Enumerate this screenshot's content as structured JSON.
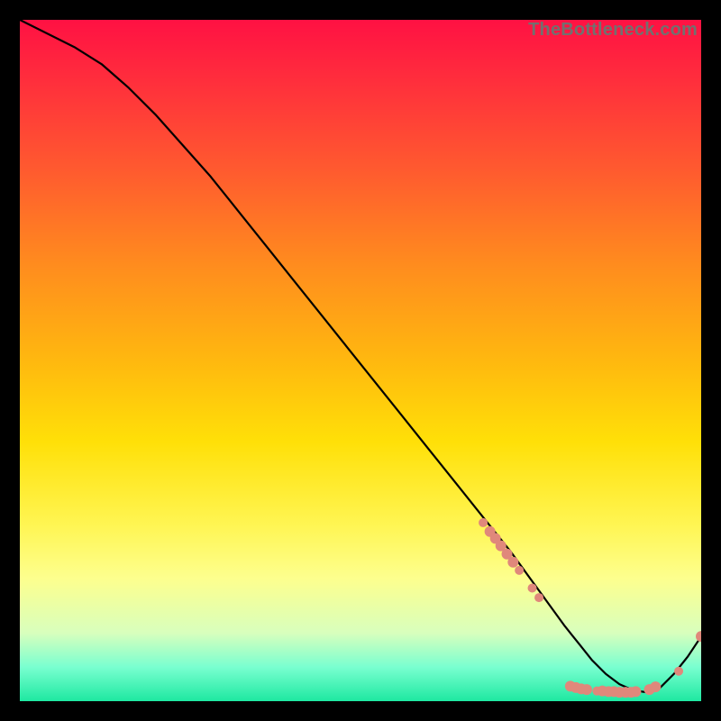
{
  "watermark": "TheBottleneck.com",
  "chart_data": {
    "type": "line",
    "title": "",
    "xlabel": "",
    "ylabel": "",
    "xlim": [
      0,
      100
    ],
    "ylim": [
      0,
      100
    ],
    "grid": false,
    "legend": false,
    "curve": {
      "name": "bottleneck-curve",
      "x": [
        0,
        4,
        8,
        12,
        16,
        20,
        24,
        28,
        32,
        36,
        40,
        44,
        48,
        52,
        56,
        60,
        64,
        68,
        72,
        76,
        80,
        82,
        84,
        86,
        88,
        90,
        92,
        94,
        96,
        98,
        100
      ],
      "y": [
        100,
        98,
        96,
        93.5,
        90,
        86,
        81.5,
        77,
        72,
        67,
        62,
        57,
        52,
        47,
        42,
        37,
        32,
        27,
        22,
        16.5,
        11,
        8.5,
        6,
        4,
        2.5,
        1.6,
        1.3,
        2,
        4,
        6.5,
        9.5
      ]
    },
    "scatter": {
      "name": "highlight-points",
      "color": "#e0887b",
      "points": [
        {
          "x": 68.0,
          "y": 26.2,
          "r": 5
        },
        {
          "x": 69.0,
          "y": 24.9,
          "r": 6
        },
        {
          "x": 69.8,
          "y": 23.9,
          "r": 6
        },
        {
          "x": 70.6,
          "y": 22.8,
          "r": 6
        },
        {
          "x": 71.5,
          "y": 21.6,
          "r": 6
        },
        {
          "x": 72.4,
          "y": 20.4,
          "r": 6
        },
        {
          "x": 73.3,
          "y": 19.2,
          "r": 5
        },
        {
          "x": 75.2,
          "y": 16.6,
          "r": 5
        },
        {
          "x": 76.2,
          "y": 15.2,
          "r": 5
        },
        {
          "x": 80.8,
          "y": 2.2,
          "r": 6
        },
        {
          "x": 81.6,
          "y": 2.0,
          "r": 6
        },
        {
          "x": 82.4,
          "y": 1.8,
          "r": 6
        },
        {
          "x": 83.2,
          "y": 1.7,
          "r": 6
        },
        {
          "x": 84.7,
          "y": 1.5,
          "r": 5
        },
        {
          "x": 85.5,
          "y": 1.5,
          "r": 6
        },
        {
          "x": 86.4,
          "y": 1.4,
          "r": 6
        },
        {
          "x": 87.2,
          "y": 1.4,
          "r": 6
        },
        {
          "x": 88.0,
          "y": 1.3,
          "r": 6
        },
        {
          "x": 88.9,
          "y": 1.3,
          "r": 6
        },
        {
          "x": 89.7,
          "y": 1.3,
          "r": 6
        },
        {
          "x": 90.4,
          "y": 1.4,
          "r": 6
        },
        {
          "x": 92.4,
          "y": 1.7,
          "r": 6
        },
        {
          "x": 93.3,
          "y": 2.1,
          "r": 6
        },
        {
          "x": 96.7,
          "y": 4.4,
          "r": 5
        },
        {
          "x": 100.0,
          "y": 9.5,
          "r": 6
        }
      ]
    }
  }
}
